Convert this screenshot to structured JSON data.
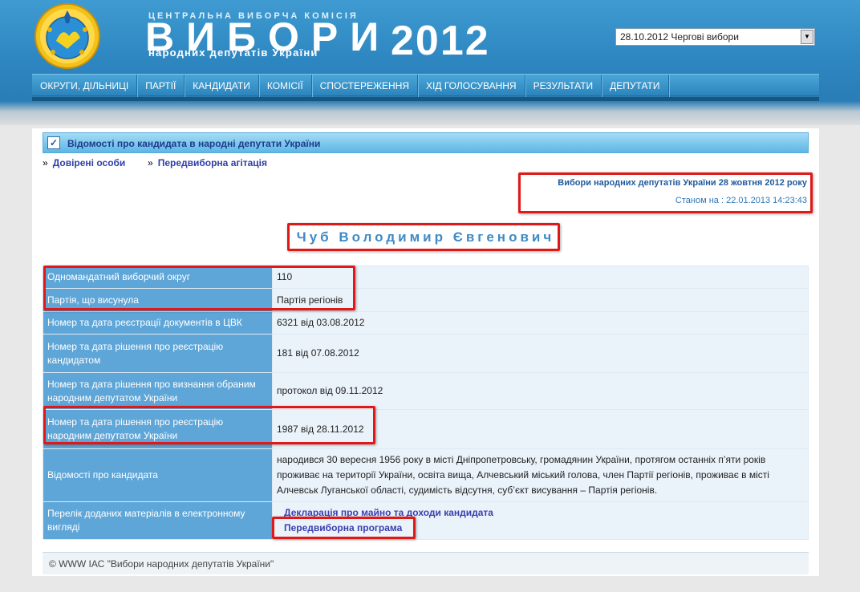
{
  "header": {
    "cvk_line": "ЦЕНТРАЛЬНА ВИБОРЧА КОМІСІЯ",
    "vybory_word": "ВИБОРИ",
    "deputies_line": "народних депутатів України",
    "year": "2012",
    "election_select": "28.10.2012 Чергові вибори"
  },
  "nav": {
    "items": [
      "ОКРУГИ, ДІЛЬНИЦІ",
      "ПАРТІЇ",
      "КАНДИДАТИ",
      "КОМІСІЇ",
      "СПОСТЕРЕЖЕННЯ",
      "ХІД ГОЛОСУВАННЯ",
      "РЕЗУЛЬТАТИ",
      "ДЕПУТАТИ"
    ]
  },
  "section": {
    "title": "Відомості про кандидата в народні депутати України"
  },
  "links": {
    "arrow": "»",
    "items": [
      "Довірені особи",
      "Передвиборна агітація"
    ]
  },
  "election": {
    "name": "Вибори народних депутатів України 28 жовтня 2012 року",
    "status": "Станом на : 22.01.2013 14:23:43"
  },
  "candidate": {
    "name": "Чуб Володимир Євгенович"
  },
  "table": {
    "rows": [
      {
        "label": "Одномандатний виборчий округ",
        "value": "110"
      },
      {
        "label": "Партія, що висунула",
        "value": "Партія регіонів"
      },
      {
        "label": "Номер та дата реєстрації документів в ЦВК",
        "value": "6321 від 03.08.2012"
      },
      {
        "label": "Номер та дата рішення про реєстрацію кандидатом",
        "value": "181 від 07.08.2012"
      },
      {
        "label": "Номер та дата рішення про визнання обраним народним депутатом України",
        "value": "протокол від 09.11.2012"
      },
      {
        "label": "Номер та дата рішення про реєстрацію народним депутатом України",
        "value": "1987 від 28.11.2012"
      },
      {
        "label": "Відомості про кандидата",
        "value": "народився 30 вересня 1956 року в місті Дніпропетровську, громадянин України, протягом останніх п’яти років проживає на території України, освіта вища, Алчевський міський голова, член Партії регіонів, проживає в місті Алчевськ Луганської області, судимість відсутня, суб’єкт висування – Партія регіонів."
      },
      {
        "label": "Перелік доданих матеріалів в електронному вигляді",
        "links": [
          "Декларація про майно та доходи кандидата",
          "Передвиборна програма"
        ]
      }
    ]
  },
  "footer": {
    "text": "© WWW ІАС \"Вибори народних депутатів України\""
  }
}
